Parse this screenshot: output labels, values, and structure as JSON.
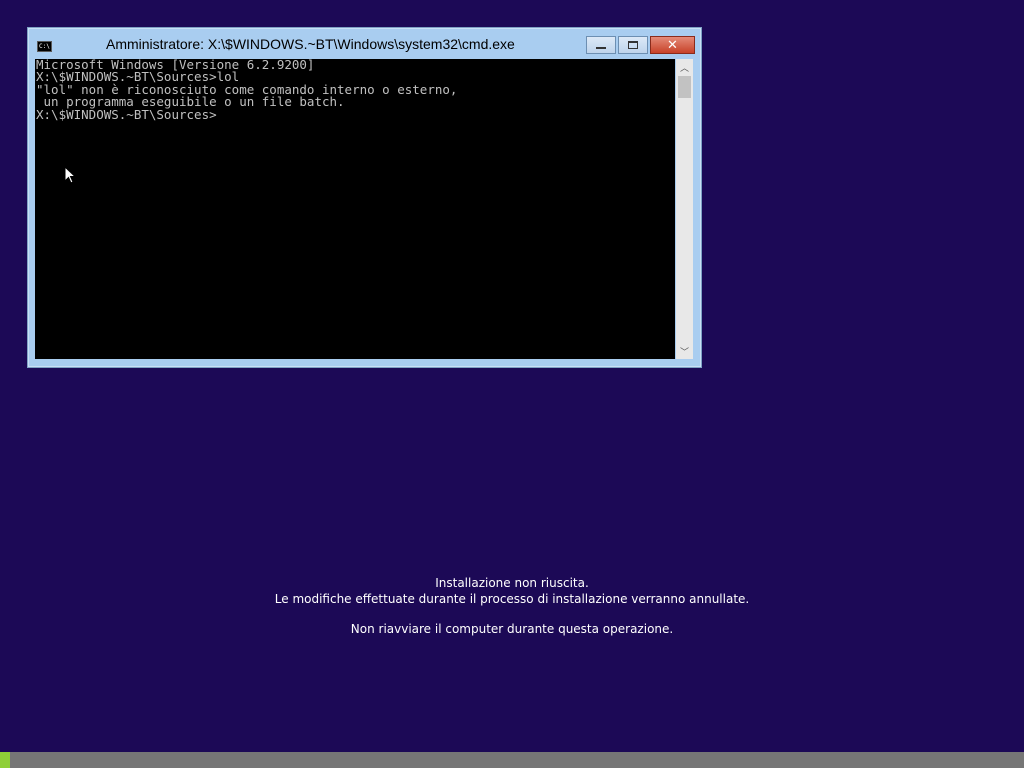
{
  "window": {
    "title": "Amministratore: X:\\$WINDOWS.~BT\\Windows\\system32\\cmd.exe",
    "icon": "cmd-icon",
    "icon_text": "C:\\.",
    "minimize_label": "",
    "maximize_label": "",
    "close_label": "✕"
  },
  "console": {
    "lines": [
      "Microsoft Windows [Versione 6.2.9200]",
      "",
      "",
      "X:\\$WINDOWS.~BT\\Sources>lol",
      "\"lol\" non è riconosciuto come comando interno o esterno,",
      " un programma eseguibile o un file batch.",
      "",
      "X:\\$WINDOWS.~BT\\Sources>"
    ]
  },
  "setup": {
    "line1": "Installazione non riuscita.",
    "line2": "Le modifiche effettuate durante il processo di installazione verranno annullate.",
    "line3": "Non riavviare il computer durante questa operazione."
  },
  "progress": {
    "value": 0.01,
    "color": "#8fcf38"
  },
  "colors": {
    "background": "#1c0956",
    "console_bg": "#000000",
    "console_text": "#c0c0c0"
  }
}
